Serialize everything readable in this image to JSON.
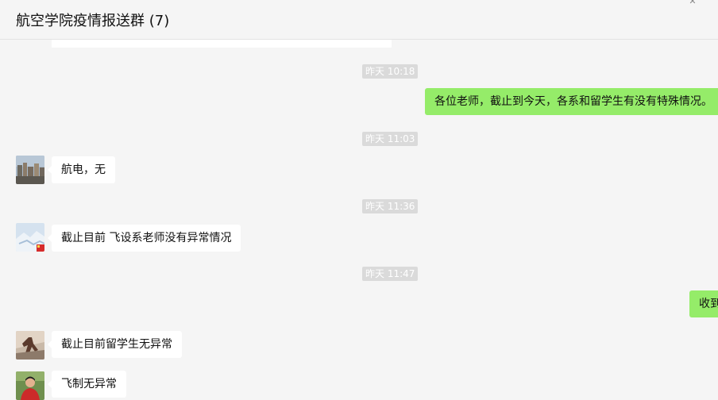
{
  "header": {
    "title": "航空学院疫情报送群 (7)",
    "pin_icon": "pin-icon"
  },
  "messages": [
    {
      "type": "time",
      "text": "昨天 10:18"
    },
    {
      "type": "outgoing",
      "text": "各位老师，截止到今天，各系和留学生有没有特殊情况。"
    },
    {
      "type": "time",
      "text": "昨天 11:03"
    },
    {
      "type": "incoming",
      "text": "航电，无",
      "avatar": "landscape-avatar"
    },
    {
      "type": "time",
      "text": "昨天 11:36"
    },
    {
      "type": "incoming",
      "text": "截止目前 飞设系老师没有异常情况",
      "avatar": "snow-avatar"
    },
    {
      "type": "time",
      "text": "昨天 11:47"
    },
    {
      "type": "outgoing",
      "text": "收到"
    },
    {
      "type": "incoming",
      "text": "截止目前留学生无异常",
      "avatar": "figure-avatar"
    },
    {
      "type": "incoming",
      "text": "飞制无异常",
      "avatar": "person-avatar"
    }
  ],
  "colors": {
    "background": "#f5f5f5",
    "outgoing_bubble": "#95ec69",
    "incoming_bubble": "#ffffff",
    "timestamp_badge": "#dadada"
  }
}
